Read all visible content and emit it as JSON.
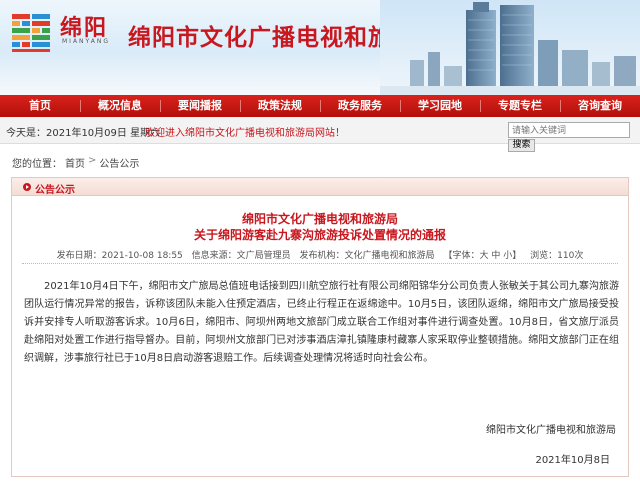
{
  "header": {
    "logo_cn": "绵阳",
    "logo_en": "MIANYANG",
    "site_title": "绵阳市文化广播电视和旅游局"
  },
  "nav": {
    "items": [
      {
        "label": "首页"
      },
      {
        "label": "概况信息"
      },
      {
        "label": "要闻播报"
      },
      {
        "label": "政策法规"
      },
      {
        "label": "政务服务"
      },
      {
        "label": "学习园地"
      },
      {
        "label": "专题专栏"
      },
      {
        "label": "咨询查询"
      }
    ]
  },
  "infobar": {
    "today": "今天是：2021年10月09日 星期六",
    "welcome": "欢迎进入绵阳市文化广播电视和旅游局网站！",
    "search_placeholder": "请输入关键词",
    "search_button": "搜索"
  },
  "breadcrumb": {
    "prefix": "您的位置：",
    "home": "首页",
    "sep": ">",
    "current": "公告公示"
  },
  "panel": {
    "title": "公告公示"
  },
  "article": {
    "title_line1": "绵阳市文化广播电视和旅游局",
    "title_line2": "关于绵阳游客赴九寨沟旅游投诉处置情况的通报",
    "published": "发布日期：2021-10-08 18:55",
    "source": "信息来源：文广局管理员",
    "publisher": "发布机构：文化广播电视和旅游局",
    "size_label": "【字体：",
    "size_large": "大",
    "size_medium": "中",
    "size_small": "小",
    "size_close": "】",
    "views": "浏览：110次",
    "body": "2021年10月4日下午，绵阳市文广旅局总值班电话接到四川航空旅行社有限公司绵阳锦华分公司负责人张敏关于其公司九寨沟旅游团队运行情况异常的报告，诉称该团队未能入住预定酒店，已终止行程正在返绵途中。10月5日，该团队返绵，绵阳市文广旅局接受投诉并安排专人听取游客诉求。10月6日，绵阳市、阿坝州两地文旅部门成立联合工作组对事件进行调查处置。10月8日，省文旅厅派员赴绵阳对处置工作进行指导督办。目前，阿坝州文旅部门已对涉事酒店漳扎镇隆康村藏寨人家采取停业整顿措施。绵阳文旅部门正在组织调解，涉事旅行社已于10月8日启动游客退赔工作。后续调查处理情况将适时向社会公布。",
    "signature": "绵阳市文化广播电视和旅游局",
    "date": "2021年10月8日"
  }
}
